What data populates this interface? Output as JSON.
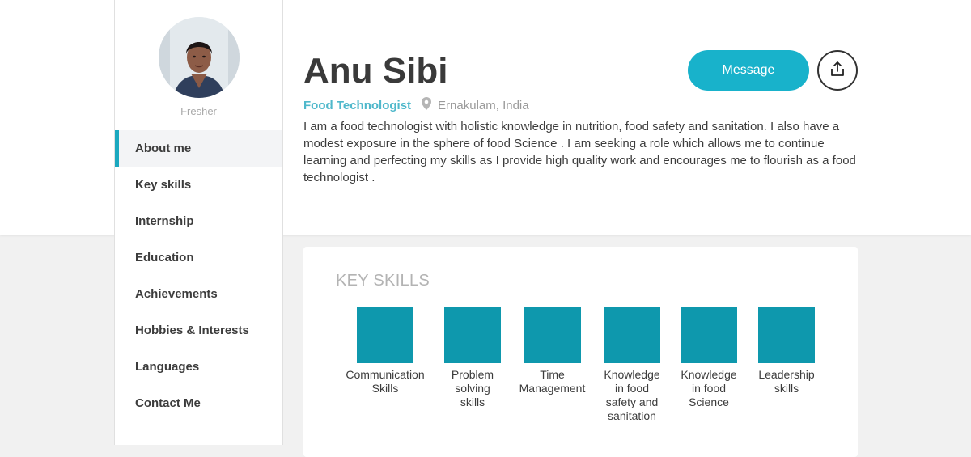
{
  "profile": {
    "name": "Anu Sibi",
    "status": "Fresher",
    "role": "Food Technologist",
    "location": "Ernakulam, India",
    "bio": "I am a food technologist with holistic knowledge in nutrition, food safety and sanitation. I also have a modest exposure in the sphere of food Science . I am seeking a role which allows me to continue learning and perfecting my skills as I provide high quality work and encourages me to flourish as a food technologist ."
  },
  "actions": {
    "message_label": "Message",
    "share_icon": "share-upload-icon"
  },
  "sidebar": {
    "items": [
      {
        "label": "About me",
        "active": true
      },
      {
        "label": "Key skills",
        "active": false
      },
      {
        "label": "Internship",
        "active": false
      },
      {
        "label": "Education",
        "active": false
      },
      {
        "label": "Achievements",
        "active": false
      },
      {
        "label": "Hobbies & Interests",
        "active": false
      },
      {
        "label": "Languages",
        "active": false
      },
      {
        "label": "Contact Me",
        "active": false
      }
    ]
  },
  "key_skills": {
    "title": "KEY SKILLS",
    "skills": [
      "Communication\nSkills",
      "Problem\nsolving\nskills",
      "Time\nManagement",
      "Knowledge\nin food\nsafety and\nsanitation",
      "Knowledge\nin food\nScience",
      "Leadership\nskills"
    ]
  },
  "colors": {
    "accent": "#18b2cb",
    "skill_tile": "#0e98ad",
    "role_text": "#4fb8cb"
  }
}
